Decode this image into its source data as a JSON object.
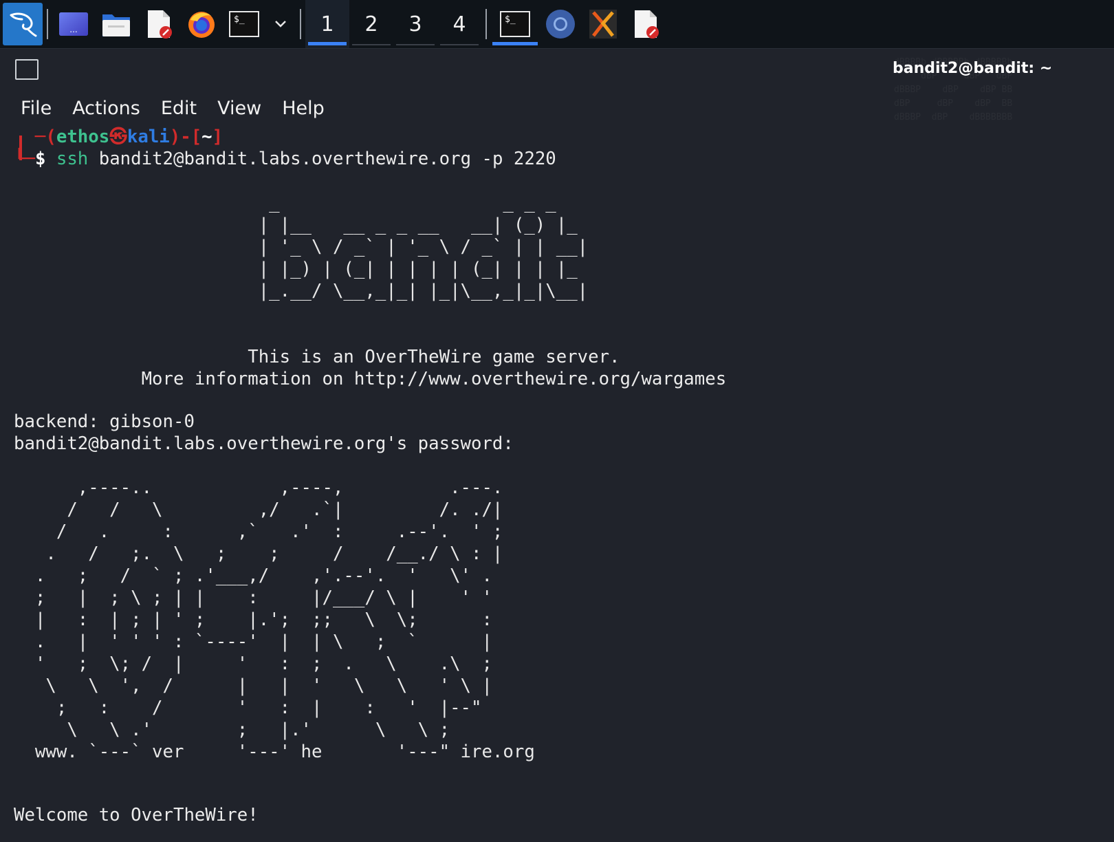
{
  "taskbar": {
    "workspaces": [
      "1",
      "2",
      "3",
      "4"
    ],
    "active_workspace": "1"
  },
  "window": {
    "title": "bandit2@bandit: ~",
    "menu": [
      "File",
      "Actions",
      "Edit",
      "View",
      "Help"
    ]
  },
  "terminal": {
    "prompt": {
      "user": "ethos",
      "at_symbol": "㉿",
      "host": "kali",
      "dir": "~",
      "dollar": "$",
      "command_name": "ssh",
      "command_args": " bandit2@bandit.labs.overthewire.org -p 2220"
    },
    "bandit_art": "                        _                     _ _ _   \n                       | |__   __ _ _ __   __| (_) |_ \n                       | '_ \\ / _` | '_ \\ / _` | | __|\n                       | |_) | (_| | | | | (_| | | |_ \n                       |_.__/ \\__,_|_| |_|\\__,_|_|\\__|",
    "server_line1": "                      This is an OverTheWire game server.",
    "server_line2": "            More information on http://www.overthewire.org/wargames",
    "backend": "backend: gibson-0",
    "password_prompt": "bandit2@bandit.labs.overthewire.org's password:",
    "otw_art": "      ,----..            ,----,          .---.\n     /   /   \\         ,/   .`|         /. ./|\n    /   .     :      ,`   .'  :     .--'.  ' ;\n   .   /   ;.  \\   ;    ;     /    /__./ \\ : |\n  .   ;   /  ` ; .'___,/    ,'.--'.  '   \\' .\n  ;   |  ; \\ ; | |    :     |/___/ \\ |    ' '\n  |   :  | ; | ' ;    |.';  ;;   \\  \\;      :\n  .   |  ' ' ' : `----'  |  | \\   ;  `      |\n  '   ;  \\; /  |     '   :  ;  .   \\    .\\  ;\n   \\   \\  ',  /      |   |  '   \\   \\   ' \\ |\n    ;   :    /       '   :  |    :   '  |--\"\n     \\   \\ .'        ;   |.'      \\   \\ ;\n  www. `---` ver     '---' he       '---\" ire.org",
    "welcome": "Welcome to OverTheWire!"
  },
  "colors": {
    "accent": "#3b82f6",
    "prompt_red": "#d12b2b",
    "prompt_green": "#3ec28f",
    "prompt_blue": "#2f7de3"
  },
  "icons": [
    "kali-dragon-icon",
    "desktop-icon",
    "file-manager-icon",
    "text-editor-icon",
    "firefox-icon",
    "terminal-icon",
    "chevron-down-icon",
    "terminal-icon",
    "chromium-icon",
    "xampp-icon",
    "text-editor-icon"
  ]
}
